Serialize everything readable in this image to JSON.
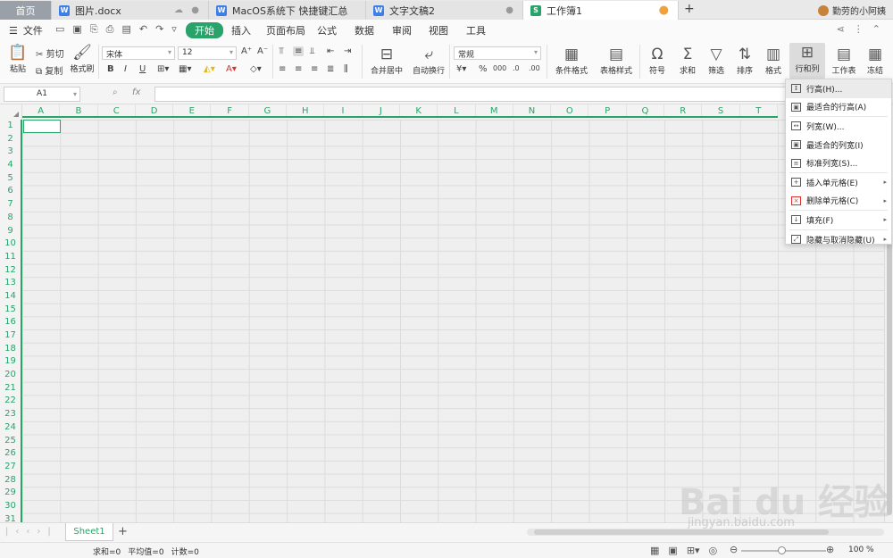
{
  "tabs": [
    {
      "label": "首页",
      "type": "home"
    },
    {
      "label": "图片.docx",
      "type": "word"
    },
    {
      "label": "MacOS系统下 快捷键汇总",
      "type": "word"
    },
    {
      "label": "文字文稿2",
      "type": "word"
    },
    {
      "label": "工作簿1",
      "type": "sheet",
      "active": true
    }
  ],
  "new_tab": "+",
  "user_name": "勤劳的小阿姨",
  "menu": {
    "file": "文件",
    "items": [
      "开始",
      "插入",
      "页面布局",
      "公式",
      "数据",
      "审阅",
      "视图",
      "工具"
    ],
    "active": "开始"
  },
  "ribbon": {
    "paste": "粘贴",
    "cut": "剪切",
    "copy": "复制",
    "format_painter": "格式刷",
    "font_name": "宋体",
    "font_size": "12",
    "merge_center": "合并居中",
    "wrap_text": "自动换行",
    "number_format": "常规",
    "conditional_format": "条件格式",
    "table_style": "表格样式",
    "symbol": "符号",
    "sum": "求和",
    "filter": "筛选",
    "sort": "排序",
    "format": "格式",
    "rows_cols": "行和列",
    "worksheet": "工作表",
    "freeze": "冻结"
  },
  "formula_bar": {
    "name_box": "A1",
    "fx": "fx"
  },
  "columns": [
    "A",
    "B",
    "C",
    "D",
    "E",
    "F",
    "G",
    "H",
    "I",
    "J",
    "K",
    "L",
    "M",
    "N",
    "O",
    "P",
    "Q",
    "R",
    "S",
    "T"
  ],
  "rows": [
    "1",
    "2",
    "3",
    "4",
    "5",
    "6",
    "7",
    "8",
    "9",
    "10",
    "11",
    "12",
    "13",
    "14",
    "15",
    "16",
    "17",
    "18",
    "19",
    "20",
    "21",
    "22",
    "23",
    "24",
    "25",
    "26",
    "27",
    "28",
    "29",
    "30",
    "31"
  ],
  "dropdown_menu": [
    {
      "label": "行高(H)...",
      "submenu": false
    },
    {
      "label": "最适合的行高(A)",
      "submenu": false
    },
    {
      "label": "列宽(W)...",
      "submenu": false
    },
    {
      "label": "最适合的列宽(I)",
      "submenu": false
    },
    {
      "label": "标准列宽(S)...",
      "submenu": false
    },
    {
      "label": "插入单元格(E)",
      "submenu": true
    },
    {
      "label": "删除单元格(C)",
      "submenu": true
    },
    {
      "label": "填充(F)",
      "submenu": true
    },
    {
      "label": "隐藏与取消隐藏(U)",
      "submenu": true
    }
  ],
  "sheet_tab": "Sheet1",
  "add_sheet": "+",
  "status": {
    "sum": "求和=0",
    "avg": "平均值=0",
    "count": "计数=0",
    "zoom": "100 %"
  },
  "watermark": {
    "main": "Bai du 经验",
    "sub": "jingyan.baidu.com"
  },
  "colors": {
    "accent": "#2aa36b",
    "word": "#3d7fe6"
  }
}
